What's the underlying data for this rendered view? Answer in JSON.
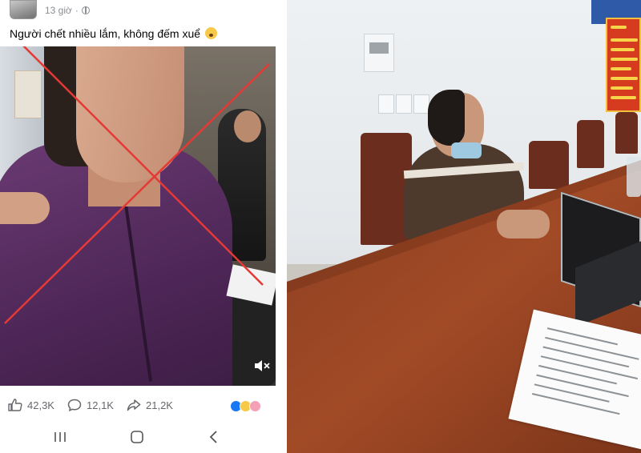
{
  "post": {
    "time": "13 giờ",
    "caption": "Người chết nhiều lắm, không đếm xuể"
  },
  "stats": {
    "likes": "42,3K",
    "comments": "12,1K",
    "shares": "21,2K"
  },
  "colors": {
    "cross_mark": "#e53935",
    "meta_text": "#65676b",
    "like_blue": "#1877f2"
  },
  "icons": {
    "like": "thumbs-up-icon",
    "comment": "comment-bubble-icon",
    "share": "share-arrow-icon",
    "mute": "speaker-muted-icon",
    "visibility": "globe-icon"
  }
}
